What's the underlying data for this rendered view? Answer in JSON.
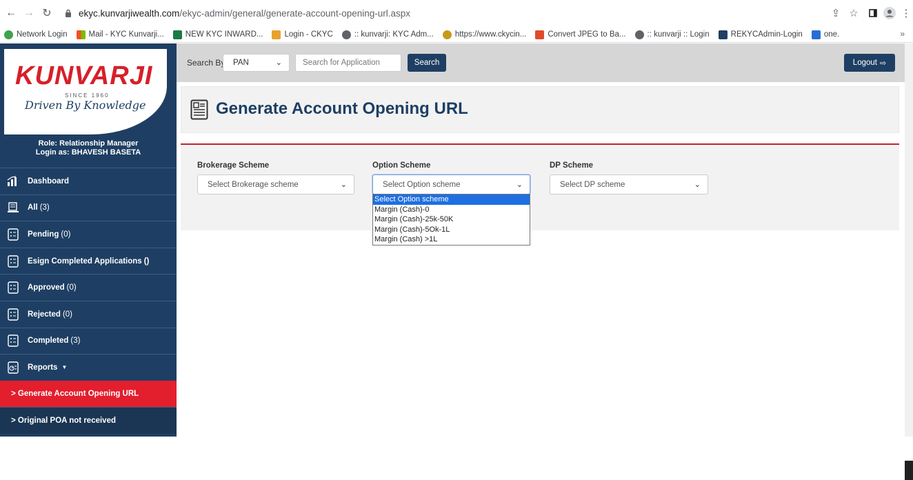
{
  "browser": {
    "url_host": "ekyc.kunvarjiwealth.com",
    "url_path": "/ekyc-admin/general/generate-account-opening-url.aspx",
    "bookmarks": [
      {
        "label": "Network Login",
        "color": "#3fa34d"
      },
      {
        "label": "Mail - KYC Kunvarji...",
        "color": "#e84a2c"
      },
      {
        "label": "NEW KYC INWARD...",
        "color": "#1d7a45"
      },
      {
        "label": "Login - CKYC",
        "color": "#e8a22c"
      },
      {
        "label": ":: kunvarji: KYC Adm...",
        "color": "#5f6368"
      },
      {
        "label": "https://www.ckycin...",
        "color": "#c79a1a"
      },
      {
        "label": "Convert JPEG to Ba...",
        "color": "#e04a2a"
      },
      {
        "label": ":: kunvarji :: Login",
        "color": "#5f6368"
      },
      {
        "label": "REKYCAdmin-Login",
        "color": "#1e3f63"
      },
      {
        "label": "one.",
        "color": "#2a6dd6"
      }
    ]
  },
  "sidebar": {
    "logo": "KUNVARJI",
    "since": "SINCE 1960",
    "tagline": "Driven By Knowledge",
    "role": "Role: Relationship Manager",
    "login_as": "Login as: BHAVESH BASETA",
    "items": [
      {
        "label": "Dashboard",
        "count": ""
      },
      {
        "label": "All",
        "count": "(3)"
      },
      {
        "label": "Pending",
        "count": "(0)"
      },
      {
        "label": "Esign Completed Applications",
        "count": "()"
      },
      {
        "label": "Approved",
        "count": "(0)"
      },
      {
        "label": "Rejected",
        "count": "(0)"
      },
      {
        "label": "Completed",
        "count": "(3)"
      },
      {
        "label": "Reports",
        "count": ""
      }
    ],
    "sub_items": [
      {
        "label": "> Generate Account Opening URL"
      },
      {
        "label": "> Original POA not received"
      }
    ]
  },
  "topbar": {
    "search_by_label": "Search By",
    "search_by_value": "PAN",
    "search_placeholder": "Search for Application",
    "search_button": "Search",
    "logout_label": "Logout"
  },
  "page": {
    "title": "Generate Account Opening URL",
    "fields": {
      "brokerage_label": "Brokerage Scheme",
      "brokerage_value": "Select Brokerage scheme",
      "option_label": "Option Scheme",
      "option_value": "Select Option scheme",
      "dp_label": "DP Scheme",
      "dp_value": "Select DP scheme"
    },
    "option_dropdown": [
      "Select Option scheme",
      "Margin (Cash)-0",
      "Margin (Cash)-25k-50K",
      "Margin (Cash)-5Ok-1L",
      "Margin (Cash) >1L"
    ]
  },
  "colors": {
    "brand_navy": "#1e3f63",
    "brand_red": "#e31e2d",
    "dropdown_highlight": "#1e6fe0"
  }
}
